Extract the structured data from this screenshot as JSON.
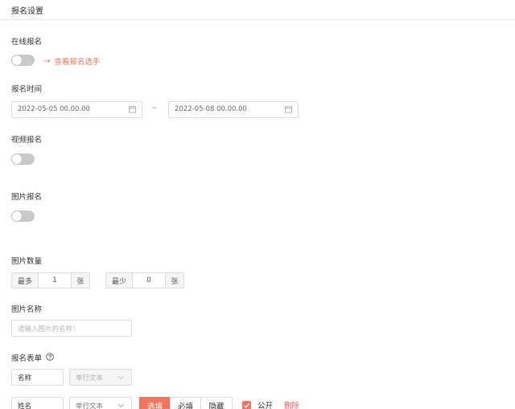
{
  "header": {
    "title": "报名设置"
  },
  "online_signup": {
    "label": "在线报名",
    "enabled": false,
    "link_text": "查看报名选手"
  },
  "signup_time": {
    "label": "报名时间",
    "start": "2022-05-05 00.00.00",
    "end": "2022-05-08 00.00.00",
    "separator": "~"
  },
  "video_signup": {
    "label": "视频报名",
    "enabled": false
  },
  "image_signup": {
    "label": "图片报名",
    "enabled": false
  },
  "image_count": {
    "label": "图片数量",
    "min_prefix": "最多",
    "min_value": "1",
    "min_suffix": "张",
    "max_prefix": "最少",
    "max_value": "0",
    "max_suffix": "张"
  },
  "image_name": {
    "label": "图片名称",
    "placeholder": "请输入图片的名称！"
  },
  "signup_form": {
    "label": "报名表单",
    "header_row": {
      "name": "名称",
      "type": "单行文本"
    },
    "rows": [
      {
        "name": "姓名",
        "type": "单行文本",
        "options": [
          "选填",
          "必填",
          "隐藏"
        ],
        "selected": "选填",
        "public_label": "公开",
        "public_checked": true,
        "delete_label": "删除"
      }
    ]
  },
  "colors": {
    "accent": "#f0755f",
    "danger": "#ee5555",
    "toggle_off": "#c9c9c9"
  }
}
